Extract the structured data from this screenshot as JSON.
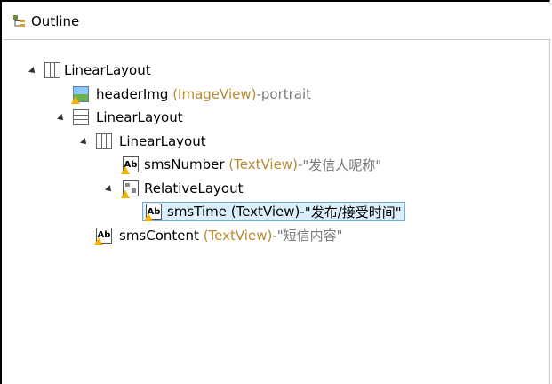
{
  "header": {
    "title": "Outline",
    "icon": "outline-tree-icon"
  },
  "tree": [
    {
      "id": "ll1",
      "name": "LinearLayout",
      "type": "",
      "sep": "",
      "desc": "",
      "icon": "linear-layout-horizontal-icon",
      "expanded": true
    },
    {
      "id": "img",
      "name": "headerImg",
      "type": "(ImageView)",
      "sep": " - ",
      "desc": "portrait",
      "icon": "image-view-icon"
    },
    {
      "id": "ll2",
      "name": "LinearLayout",
      "type": "",
      "sep": "",
      "desc": "",
      "icon": "linear-layout-vertical-icon",
      "expanded": true
    },
    {
      "id": "ll3",
      "name": "LinearLayout",
      "type": "",
      "sep": "",
      "desc": "",
      "icon": "linear-layout-horizontal-icon",
      "expanded": true
    },
    {
      "id": "num",
      "name": "smsNumber",
      "type": "(TextView)",
      "sep": " - ",
      "desc": "\"发信人昵称\"",
      "icon": "text-view-icon"
    },
    {
      "id": "rel",
      "name": "RelativeLayout",
      "type": "",
      "sep": "",
      "desc": "",
      "icon": "relative-layout-icon",
      "expanded": true
    },
    {
      "id": "time",
      "name": "smsTime",
      "type": "(TextView)",
      "sep": " - ",
      "desc": "\"发布/接受时间\"",
      "icon": "text-view-icon",
      "selected": true
    },
    {
      "id": "content",
      "name": "smsContent",
      "type": "(TextView)",
      "sep": " - ",
      "desc": "\"短信内容\"",
      "icon": "text-view-icon"
    }
  ]
}
